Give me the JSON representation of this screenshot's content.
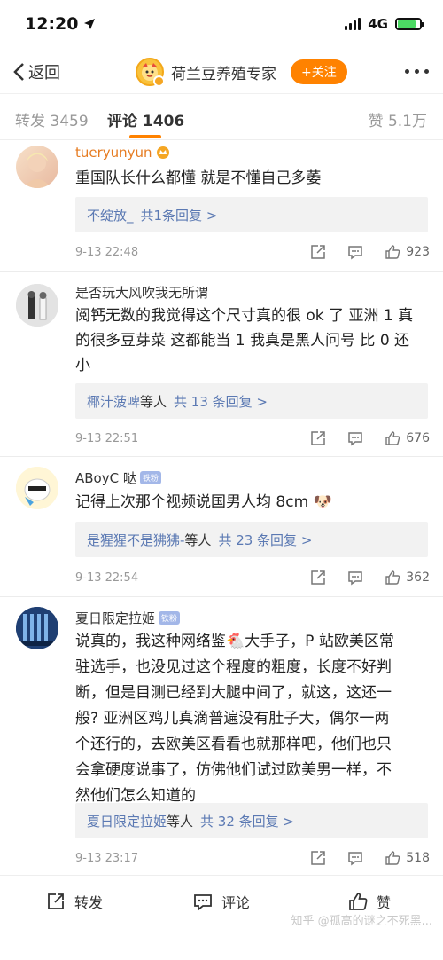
{
  "status": {
    "time": "12:20",
    "network": "4G"
  },
  "nav": {
    "back_label": "返回",
    "title": "荷兰豆养殖专家",
    "follow_label": "+关注"
  },
  "tabs": {
    "repost": "转发 3459",
    "comment": "评论 1406",
    "like": "赞 5.1万"
  },
  "comments": [
    {
      "user": "tueryunyun",
      "text_lines": [
        "重国队长什么都懂 就是不懂自己多萎"
      ],
      "reply_who": "不绽放_",
      "reply_count": "共1条回复 >",
      "time": "9-13 22:48",
      "likes": "923"
    },
    {
      "user": "是否玩大风吹我无所谓",
      "text_lines": [
        "阅钙无数的我觉得这个尺寸真的很 ok 了 亚洲 1 真",
        "的很多豆芽菜 这都能当 1 我真是黑人问号 比 0 还",
        "小"
      ],
      "reply_who": "椰汁菠啤",
      "reply_suffix": "等人",
      "reply_count": "共 13 条回复 >",
      "time": "9-13 22:51",
      "likes": "676"
    },
    {
      "user": "ABoyC 哒",
      "badge": "铁粉",
      "text_lines": [
        "记得上次那个视频说国男人均 8cm 🐶"
      ],
      "reply_who": "是猩猩不是狒狒-",
      "reply_suffix": "等人",
      "reply_count": "共 23 条回复 >",
      "time": "9-13 22:54",
      "likes": "362"
    },
    {
      "user": "夏日限定拉姬",
      "badge": "铁粉",
      "text_lines": [
        "说真的，我这种网络鉴🐔大手子，P 站欧美区常",
        "驻选手，也没见过这个程度的粗度，长度不好判",
        "断，但是目测已经到大腿中间了，就这，这还一",
        "般? 亚洲区鸡儿真滴普遍没有肚子大，偶尔一两",
        "个还行的，去欧美区看看也就那样吧，他们也只",
        "会拿硬度说事了，仿佛他们试过欧美男一样，不",
        "然他们怎么知道的"
      ],
      "reply_who": "夏日限定拉姬",
      "reply_suffix": "等人",
      "reply_count": "共 32 条回复 >",
      "time": "9-13 23:17",
      "likes": "518"
    }
  ],
  "bottom": {
    "repost": "转发",
    "comment": "评论",
    "like": "赞",
    "watermark": "知乎 @孤高的谜之不死黑..."
  },
  "colors": {
    "accent": "#ff8200",
    "link": "#5b79b3"
  }
}
